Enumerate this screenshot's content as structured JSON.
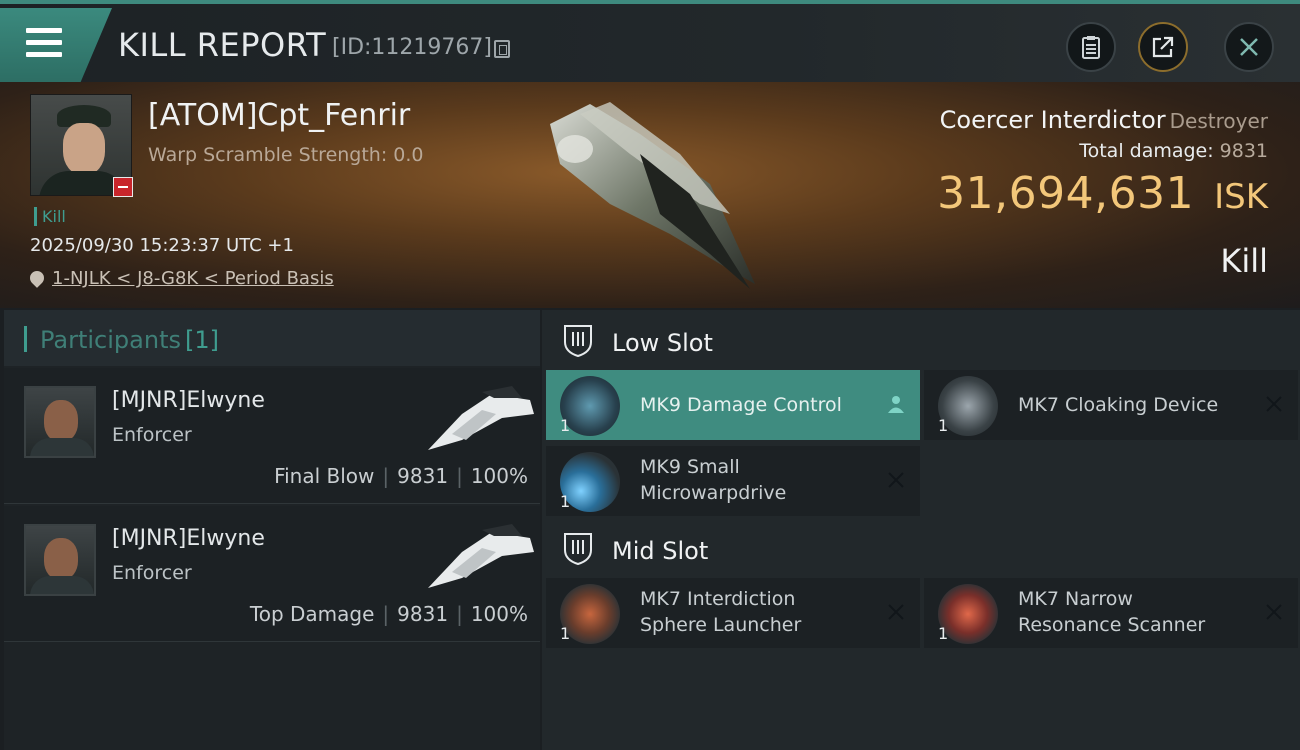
{
  "header": {
    "title": "KILL REPORT",
    "report_id": "[ID:11219767]",
    "buttons": {
      "menu": "menu-icon",
      "report": "clipboard-icon",
      "share": "share-icon",
      "close": "close-icon"
    }
  },
  "victim": {
    "name": "[ATOM]Cpt_Fenrir",
    "warp_scramble": "Warp Scramble Strength: 0.0",
    "tag": "Kill",
    "datetime": "2025/09/30 15:23:37 UTC +1",
    "location": "1-NJLK < J8-G8K < Period Basis"
  },
  "ship": {
    "name": "Coercer Interdictor",
    "class": "Destroyer",
    "total_damage_label": "Total damage:",
    "total_damage_value": "9831",
    "isk_value": "31,694,631",
    "isk_unit": "ISK",
    "result": "Kill"
  },
  "participants": {
    "label": "Participants",
    "count": "[1]",
    "items": [
      {
        "name": "[MJNR]Elwyne",
        "ship": "Enforcer",
        "role": "Final Blow",
        "damage": "9831",
        "percent": "100%"
      },
      {
        "name": "[MJNR]Elwyne",
        "ship": "Enforcer",
        "role": "Top Damage",
        "damage": "9831",
        "percent": "100%"
      }
    ]
  },
  "slots": {
    "low": {
      "label": "Low Slot",
      "modules": [
        {
          "line1": "MK9 Damage Control",
          "line2": "",
          "qty": "1",
          "status": "user-icon"
        },
        {
          "line1": "MK7 Cloaking Device",
          "line2": "",
          "qty": "1",
          "status": "close-icon"
        },
        {
          "line1": "MK9 Small",
          "line2": "Microwarpdrive",
          "qty": "1",
          "status": "close-icon"
        }
      ]
    },
    "mid": {
      "label": "Mid Slot",
      "modules": [
        {
          "line1": "MK7 Interdiction",
          "line2": "Sphere Launcher",
          "qty": "1",
          "status": "close-icon"
        },
        {
          "line1": "MK7 Narrow",
          "line2": "Resonance Scanner",
          "qty": "1",
          "status": "close-icon"
        }
      ]
    }
  },
  "colors": {
    "accent": "#3f9d8f",
    "isk": "#f3c77a",
    "danger": "#c8252b"
  }
}
